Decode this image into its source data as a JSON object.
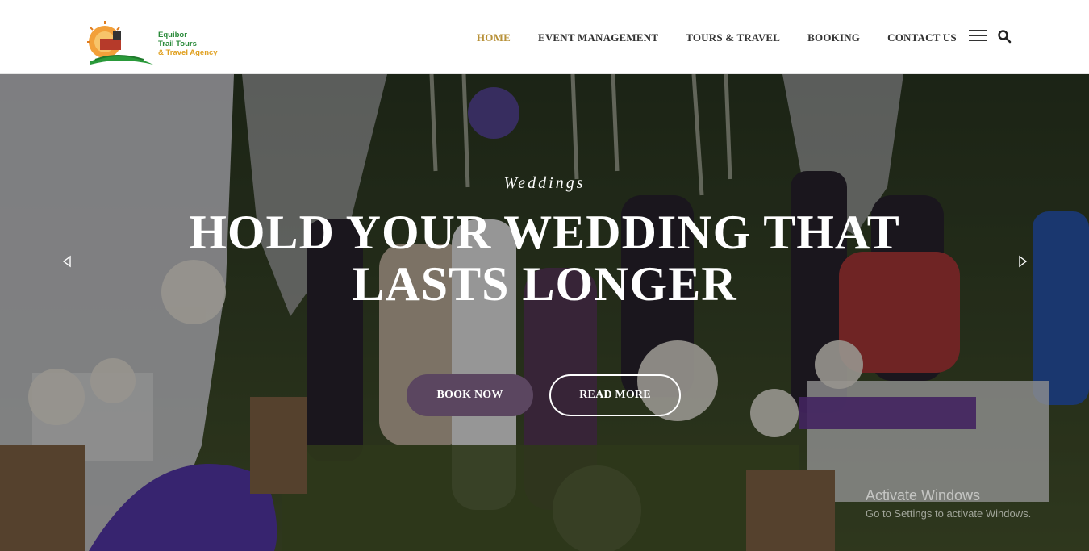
{
  "brand": {
    "line1": "Equibor",
    "line2": "Trail Tours",
    "line3": "& Travel Agency"
  },
  "nav": {
    "items": [
      "HOME",
      "EVENT MANAGEMENT",
      "TOURS & TRAVEL",
      "BOOKING",
      "CONTACT US"
    ],
    "active": "HOME"
  },
  "hero": {
    "subtitle": "Weddings",
    "title_line1": "HOLD YOUR WEDDING THAT",
    "title_line2": "LASTS LONGER",
    "book_label": "BOOK NOW",
    "read_label": "READ MORE"
  },
  "watermark": {
    "line1": "Activate Windows",
    "line2": "Go to Settings to activate Windows."
  },
  "colors": {
    "nav_active": "#b8923a",
    "book_button": "#5b4660",
    "logo_green": "#2a8a3a",
    "logo_orange": "#e0a020"
  },
  "icons": [
    "menu-icon",
    "search-icon",
    "chevron-left-icon",
    "chevron-right-icon"
  ]
}
